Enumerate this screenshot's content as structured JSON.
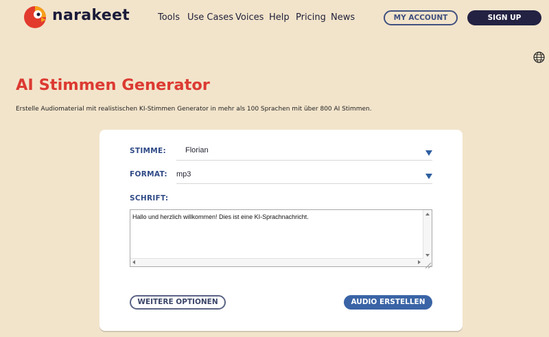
{
  "brand": {
    "name": "narakeet"
  },
  "nav": {
    "items": [
      {
        "label": "Tools"
      },
      {
        "label": "Use Cases"
      },
      {
        "label": "Voices"
      },
      {
        "label": "Help"
      },
      {
        "label": "Pricing"
      },
      {
        "label": "News"
      }
    ],
    "my_account": "MY ACCOUNT",
    "sign_up": "SIGN UP"
  },
  "page": {
    "title": "AI Stimmen Generator",
    "subtitle": "Erstelle Audiomaterial mit realistischen KI-Stimmen Generator in mehr als 100 Sprachen mit über 800 AI Stimmen."
  },
  "form": {
    "voice_label": "STIMME:",
    "voice_value": "Florian",
    "format_label": "FORMAT:",
    "format_value": "mp3",
    "script_label": "SCHRIFT:",
    "script_text": "Hallo und herzlich willkommen! Dies ist eine KI-Sprachnachricht.",
    "more_options": "WEITERE OPTIONEN",
    "create_audio": "AUDIO ERSTELLEN"
  },
  "colors": {
    "background": "#f2e4cb",
    "title_red": "#dc3a32",
    "label_blue": "#2f4a86",
    "primary_button": "#3a64a6",
    "signup_button": "#232243"
  },
  "icons": {
    "logo": "parrot-logo-icon",
    "language": "globe-icon",
    "dropdown": "triangle-down-icon"
  }
}
